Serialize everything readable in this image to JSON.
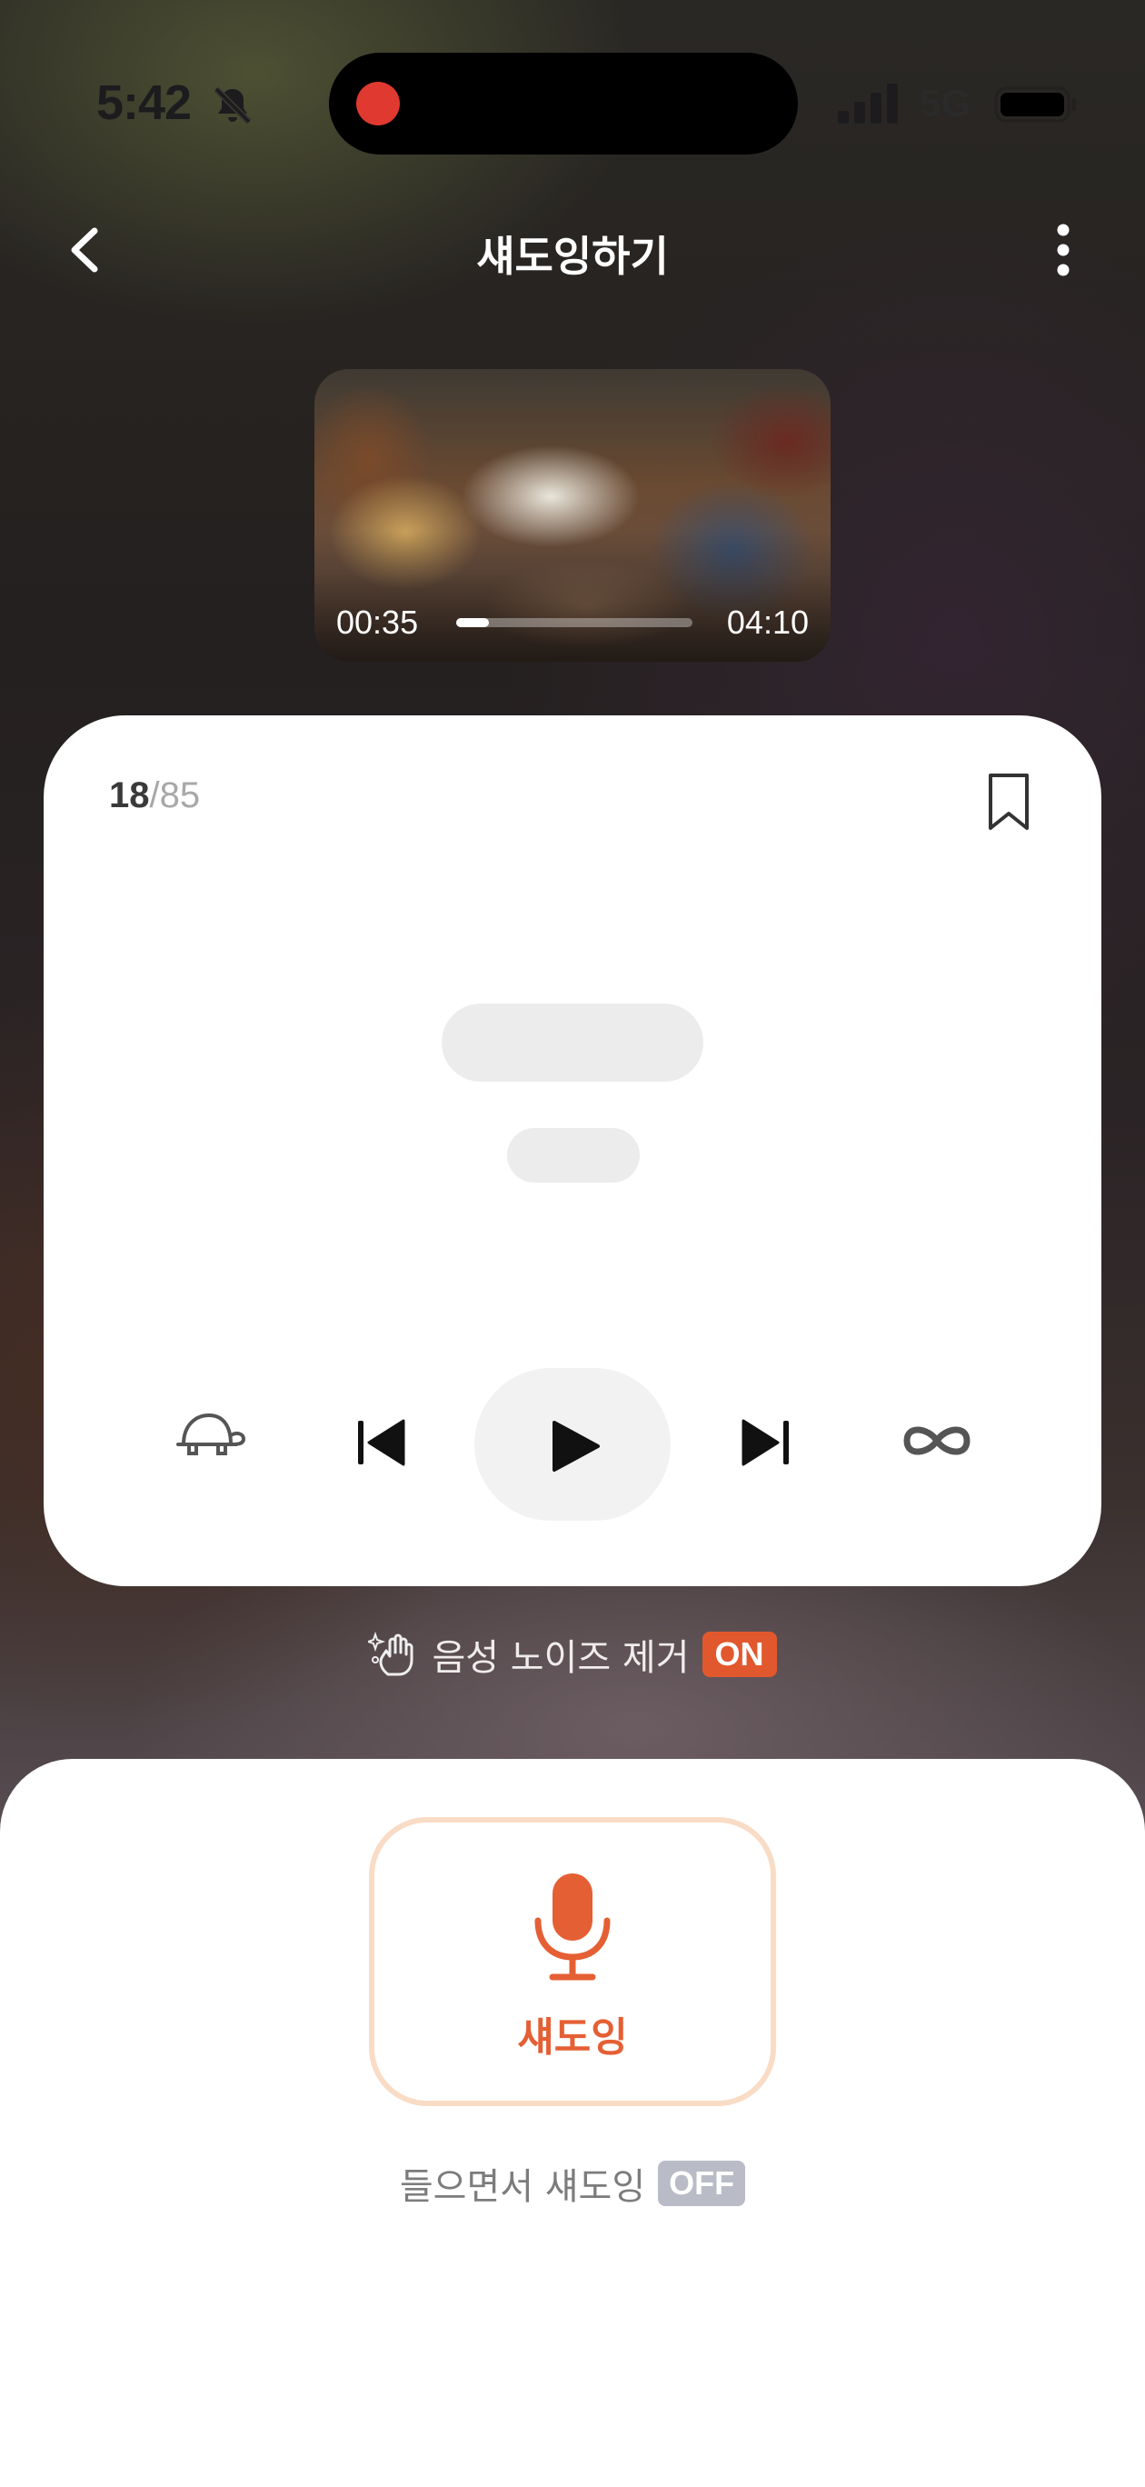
{
  "status_bar": {
    "time": "5:42",
    "network": "5G",
    "icons": [
      "bell-off-icon",
      "signal-icon",
      "battery-icon"
    ]
  },
  "header": {
    "title": "섀도잉하기",
    "icons": [
      "chevron-left-icon",
      "more-vertical-icon"
    ]
  },
  "video": {
    "current_time": "00:35",
    "duration": "04:10",
    "progress": 0.14
  },
  "sentence": {
    "current": "18",
    "separator": "/",
    "total": "85",
    "controls": [
      "turtle-slow-icon",
      "skip-previous-icon",
      "play-icon",
      "skip-next-icon",
      "infinity-repeat-icon"
    ]
  },
  "noise_removal": {
    "label": "음성 노이즈 제거",
    "state": "ON",
    "badge_color": "#e2582e"
  },
  "shadowing": {
    "button_label": "섀도잉",
    "accent_color": "#e55f34",
    "listen_label": "들으면서 섀도잉",
    "listen_state": "OFF"
  }
}
